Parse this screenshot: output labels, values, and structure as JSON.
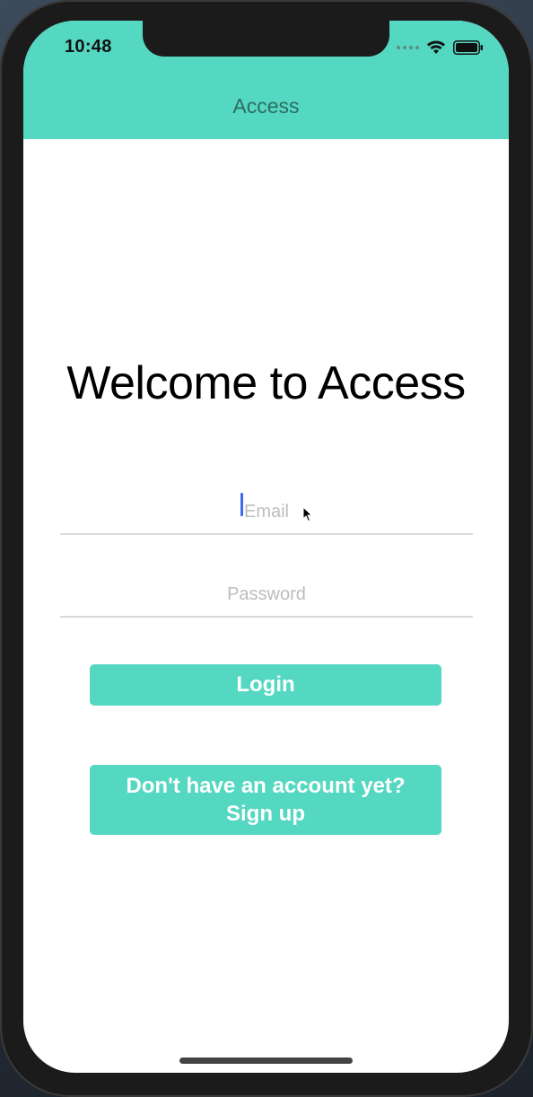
{
  "status_bar": {
    "time": "10:48",
    "icons": [
      "cellular-signal-icon",
      "wifi-icon",
      "battery-icon"
    ]
  },
  "nav": {
    "title": "Access"
  },
  "main": {
    "welcome_title": "Welcome to Access",
    "email": {
      "placeholder": "Email",
      "value": ""
    },
    "password": {
      "placeholder": "Password",
      "value": ""
    },
    "login_label": "Login",
    "signup_line1": "Don't have an account yet?",
    "signup_line2": "Sign up"
  },
  "colors": {
    "accent": "#55d8c1",
    "nav_title": "#2c6d62",
    "caret": "#3b6cf0"
  }
}
